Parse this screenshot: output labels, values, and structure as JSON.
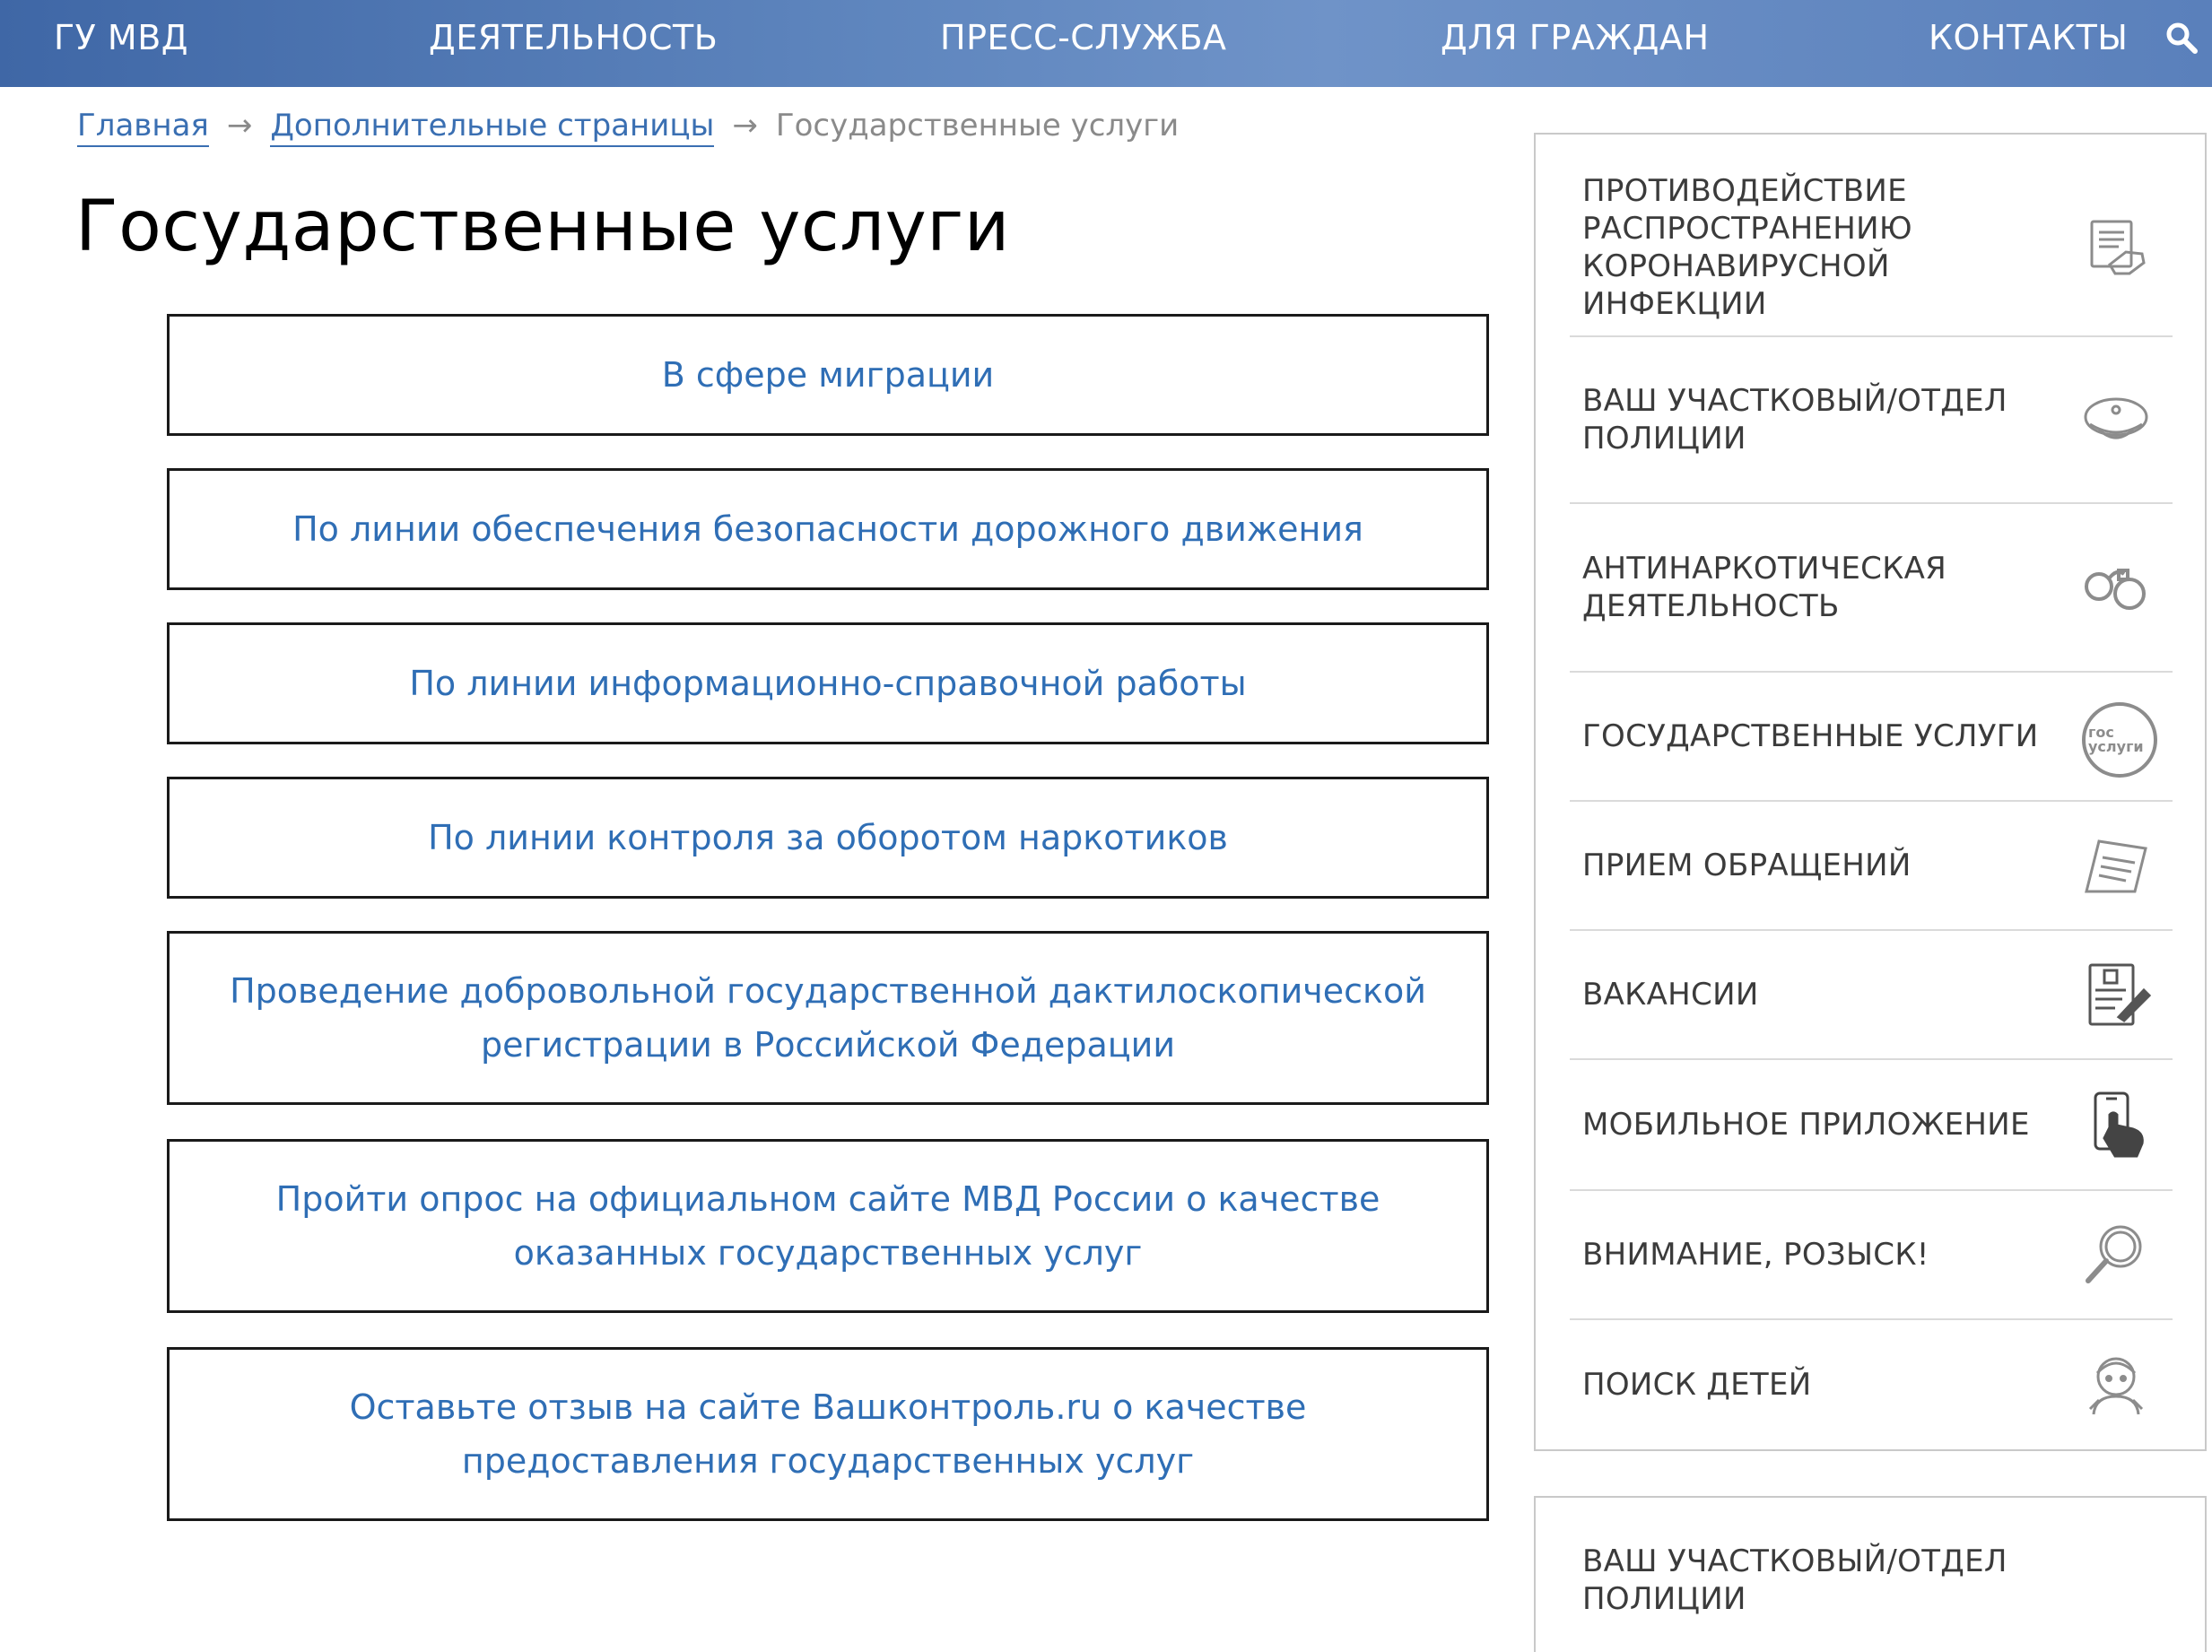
{
  "nav": {
    "items": [
      {
        "label": "ГУ МВД"
      },
      {
        "label": "ДЕЯТЕЛЬНОСТЬ"
      },
      {
        "label": "ПРЕСС-СЛУЖБА"
      },
      {
        "label": "ДЛЯ ГРАЖДАН"
      },
      {
        "label": "КОНТАКТЫ"
      }
    ],
    "search_icon": "search-icon"
  },
  "breadcrumb": {
    "home": "Главная",
    "separator": "→",
    "parent": "Дополнительные страницы",
    "current": "Государственные услуги"
  },
  "page": {
    "title": "Государственные услуги"
  },
  "services": [
    {
      "label": "В сфере миграции"
    },
    {
      "label": "По линии обеспечения безопасности дорожного движения"
    },
    {
      "label": "По линии информационно-справочной работы"
    },
    {
      "label": "По линии контроля за оборотом наркотиков"
    },
    {
      "label": "Проведение добровольной государственной дактилоскопической регистрации в Российской Федерации"
    },
    {
      "label": "Пройти опрос на официальном сайте МВД России о качестве оказанных государственных услуг"
    },
    {
      "label": "Оставьте отзыв на сайте Вашконтроль.ru о качестве предоставления государственных услуг"
    }
  ],
  "sidebar": {
    "items": [
      {
        "label": "ПРОТИВОДЕЙСТВИЕ РАСПРОСТРАНЕНИЮ КОРОНАВИРУСНОЙ ИНФЕКЦИИ",
        "icon": "document-hand-icon"
      },
      {
        "label": "ВАШ УЧАСТКОВЫЙ/ОТДЕЛ ПОЛИЦИИ",
        "icon": "police-cap-icon"
      },
      {
        "label": "АНТИНАРКОТИЧЕСКАЯ ДЕЯТЕЛЬНОСТЬ",
        "icon": "handcuffs-icon"
      },
      {
        "label": "ГОСУДАРСТВЕННЫЕ УСЛУГИ",
        "icon": "gosuslugi-icon",
        "icon_text_top": "гос",
        "icon_text_bottom": "услуги"
      },
      {
        "label": "ПРИЕМ ОБРАЩЕНИЙ",
        "icon": "paper-note-icon"
      },
      {
        "label": "ВАКАНСИИ",
        "icon": "resume-pen-icon"
      },
      {
        "label": "МОБИЛЬНОЕ ПРИЛОЖЕНИЕ",
        "icon": "smartphone-hand-icon"
      },
      {
        "label": "ВНИМАНИЕ, РОЗЫСК!",
        "icon": "magnifier-icon"
      },
      {
        "label": "ПОИСК ДЕТЕЙ",
        "icon": "child-icon"
      }
    ],
    "second_panel_label": "ВАШ УЧАСТКОВЫЙ/ОТДЕЛ ПОЛИЦИИ"
  },
  "colors": {
    "nav_gradient_start": "#3f67a6",
    "nav_gradient_end": "#6f93c8",
    "link_blue": "#2f6eb5",
    "breadcrumb_grey": "#8a8a8a",
    "sidebar_text": "#3b3b3b",
    "icon_grey": "#8c8c8c"
  }
}
